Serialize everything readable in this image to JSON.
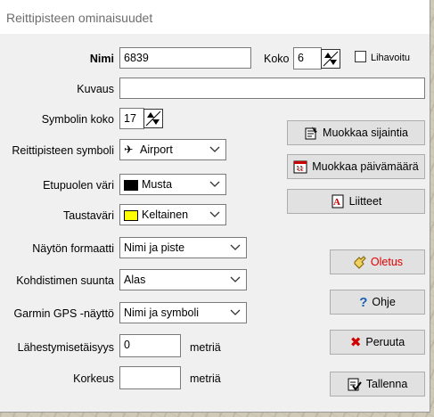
{
  "window": {
    "title": "Reittipisteen ominaisuudet"
  },
  "form": {
    "name_label": "Nimi",
    "name_value": "6839",
    "size_label": "Koko",
    "size_value": "6",
    "bold_label": "Lihavoitu",
    "bold_checked": false,
    "description_label": "Kuvaus",
    "description_value": "",
    "symbol_size_label": "Symbolin koko",
    "symbol_size_value": "17",
    "waypoint_symbol_label": "Reittipisteen symboli",
    "waypoint_symbol_value": "Airport",
    "foreground_color_label": "Etupuolen väri",
    "foreground_color_value": "Musta",
    "foreground_color_hex": "#000000",
    "background_color_label": "Taustaväri",
    "background_color_value": "Keltainen",
    "background_color_hex": "#ffff00",
    "display_format_label": "Näytön formaatti",
    "display_format_value": "Nimi ja piste",
    "cursor_direction_label": "Kohdistimen suunta",
    "cursor_direction_value": "Alas",
    "garmin_display_label": "Garmin GPS -näyttö",
    "garmin_display_value": "Nimi ja symboli",
    "proximity_label": "Lähestymisetäisyys",
    "proximity_value": "0",
    "proximity_unit": "metriä",
    "altitude_label": "Korkeus",
    "altitude_value": "",
    "altitude_unit": "metriä"
  },
  "buttons": {
    "edit_location": "Muokkaa sijaintia",
    "edit_date": "Muokkaa päivämäärä",
    "attachments": "Liitteet",
    "default": "Oletus",
    "default_color": "#e00000",
    "help": "Ohje",
    "cancel": "Peruuta",
    "save": "Tallenna"
  }
}
